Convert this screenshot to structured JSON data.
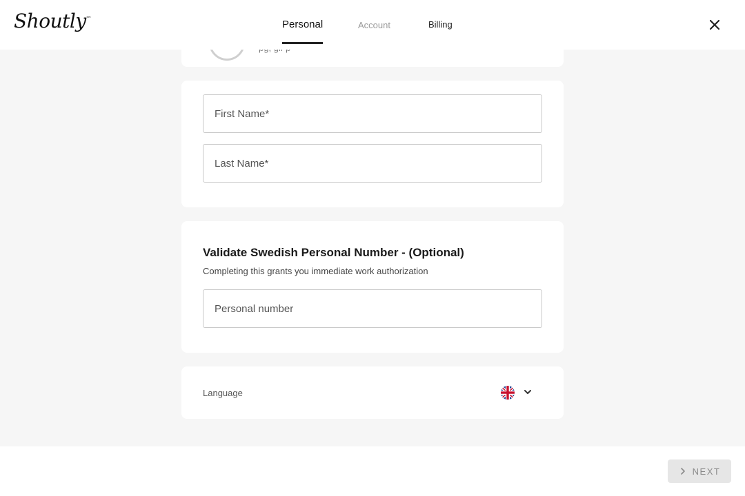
{
  "brand": {
    "logo_text": "Shoutly"
  },
  "tabs": [
    {
      "label": "Personal",
      "active": true
    },
    {
      "label": "Account",
      "active": false
    },
    {
      "label": "Billing",
      "active": false
    }
  ],
  "profile_card": {
    "peek_text": "pg, gif p"
  },
  "names": {
    "first_name_placeholder": "First Name*",
    "first_name_value": "",
    "last_name_placeholder": "Last Name*",
    "last_name_value": ""
  },
  "validate": {
    "title": "Validate Swedish Personal Number - (Optional)",
    "subtitle": "Completing this grants you immediate work authorization",
    "personal_number_placeholder": "Personal number",
    "personal_number_value": ""
  },
  "language": {
    "label": "Language",
    "selected": "english",
    "icon": "uk-flag-icon"
  },
  "footer": {
    "next_label": "NEXT"
  },
  "colors": {
    "background": "#f6f6f6",
    "card": "#ffffff",
    "button_disabled": "#e6e6e6"
  }
}
